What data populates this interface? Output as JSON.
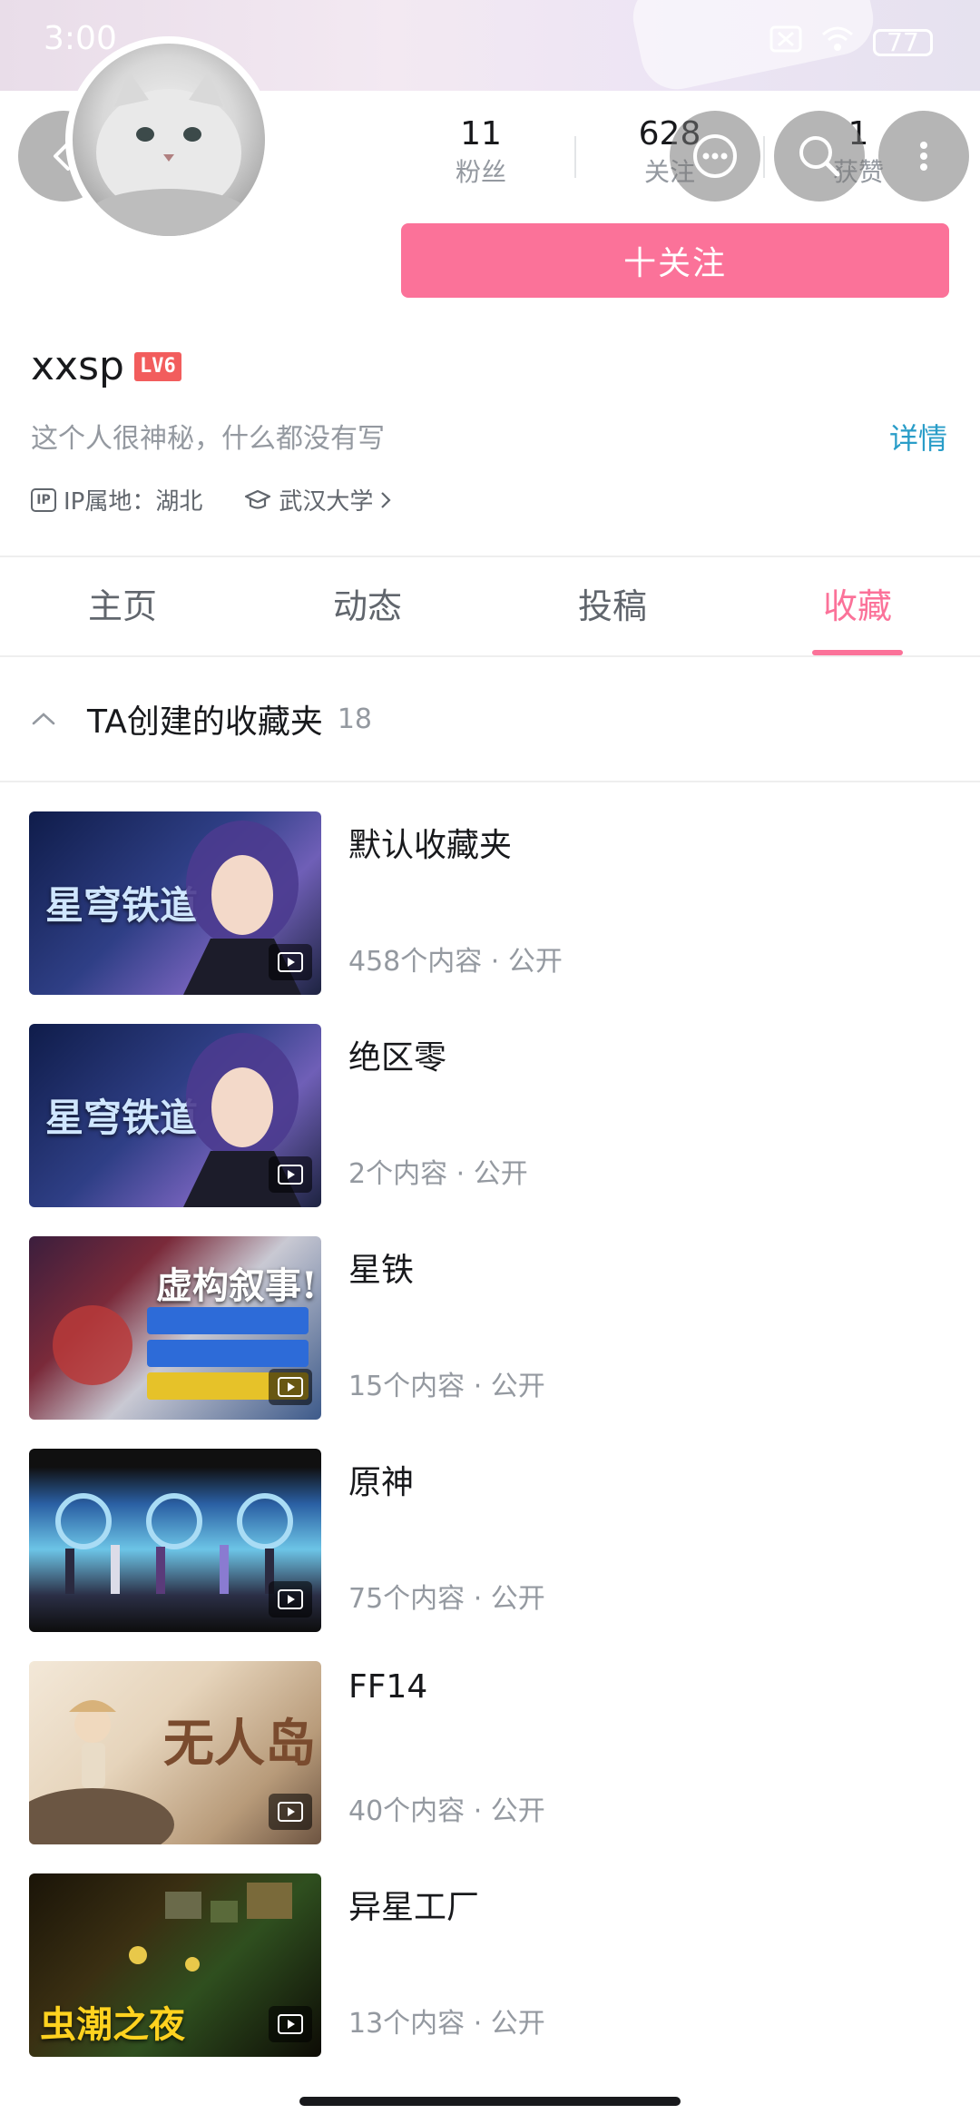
{
  "status_bar": {
    "time": "3:00",
    "battery": "77"
  },
  "profile": {
    "name": "xxsp",
    "level": "LV6",
    "bio": "这个人很神秘，什么都没有写",
    "detail_label": "详情",
    "ip_chip": "IP",
    "ip_location": "IP属地：湖北",
    "school": "武汉大学",
    "follow_button": "十关注"
  },
  "stats": [
    {
      "value": "11",
      "label": "粉丝"
    },
    {
      "value": "628",
      "label": "关注"
    },
    {
      "value": "1",
      "label": "获赞"
    }
  ],
  "tabs": [
    {
      "label": "主页",
      "active": false
    },
    {
      "label": "动态",
      "active": false
    },
    {
      "label": "投稿",
      "active": false
    },
    {
      "label": "收藏",
      "active": true
    }
  ],
  "favorites_section": {
    "title": "TA创建的收藏夹",
    "count": "18"
  },
  "folders": [
    {
      "name": "默认收藏夹",
      "meta": "458个内容 · 公开",
      "thumb_text": "星穹铁道"
    },
    {
      "name": "绝区零",
      "meta": "2个内容 · 公开",
      "thumb_text": "星穹铁道"
    },
    {
      "name": "星铁",
      "meta": "15个内容 · 公开",
      "thumb_text": "虚构叙事!"
    },
    {
      "name": "原神",
      "meta": "75个内容 · 公开",
      "thumb_text": ""
    },
    {
      "name": "FF14",
      "meta": "40个内容 · 公开",
      "thumb_text": "无人岛"
    },
    {
      "name": "异星工厂",
      "meta": "13个内容 · 公开",
      "thumb_text": "虫潮之夜"
    }
  ],
  "colors": {
    "accent": "#fb7299",
    "link": "#2a9dc8",
    "muted": "#9499a0"
  }
}
